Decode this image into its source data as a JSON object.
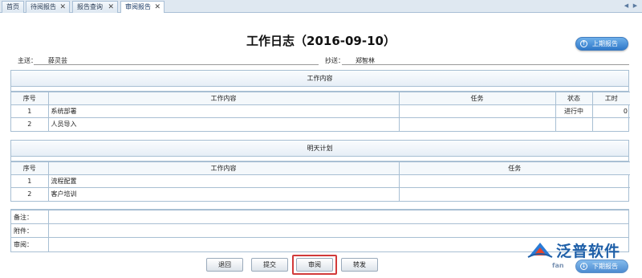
{
  "tabs": [
    {
      "label": "首页",
      "closable": false,
      "active": false
    },
    {
      "label": "待阅报告",
      "closable": true,
      "active": false
    },
    {
      "label": "报告查询",
      "closable": true,
      "active": false
    },
    {
      "label": "审阅报告",
      "closable": true,
      "active": true
    }
  ],
  "header": {
    "title": "工作日志（2016-09-10）",
    "prev_report": "上期报告",
    "next_report": "下期报告"
  },
  "meta": {
    "to_label": "主送：",
    "to_value": "薛灵芸",
    "cc_label": "抄送：",
    "cc_value": "郑智林"
  },
  "work_content": {
    "heading": "工作内容",
    "columns": [
      "序号",
      "工作内容",
      "任务",
      "状态",
      "工时"
    ],
    "rows": [
      {
        "no": "1",
        "content": "系统部署",
        "task": "",
        "status": "进行中",
        "hours": "0"
      },
      {
        "no": "2",
        "content": "人员导入",
        "task": "",
        "status": "",
        "hours": ""
      }
    ]
  },
  "tomorrow_plan": {
    "heading": "明天计划",
    "columns": [
      "序号",
      "工作内容",
      "任务"
    ],
    "rows": [
      {
        "no": "1",
        "content": "流程配置",
        "task": ""
      },
      {
        "no": "2",
        "content": "客户培训",
        "task": ""
      }
    ]
  },
  "remarks": {
    "note_label": "备注：",
    "attachment_label": "附件：",
    "review_label": "审阅："
  },
  "actions": {
    "back": "退回",
    "submit": "提交",
    "review": "审阅",
    "forward": "转发"
  },
  "logo": {
    "text": "泛普软件",
    "url_fragment": "fan"
  },
  "colors": {
    "accent": "#2f78c9",
    "border": "#a8bfd3",
    "focus": "#d23a3a"
  }
}
